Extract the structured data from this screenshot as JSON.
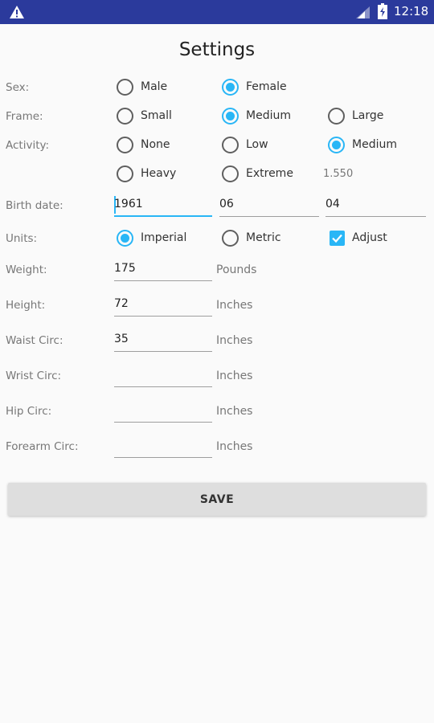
{
  "status_bar": {
    "time": "12:18"
  },
  "title": "Settings",
  "sex": {
    "label": "Sex:",
    "options": [
      "Male",
      "Female"
    ],
    "selected": "Female"
  },
  "frame": {
    "label": "Frame:",
    "options": [
      "Small",
      "Medium",
      "Large"
    ],
    "selected": "Medium"
  },
  "activity": {
    "label": "Activity:",
    "options": [
      "None",
      "Low",
      "Medium",
      "Heavy",
      "Extreme"
    ],
    "selected": "Medium",
    "factor": "1.550"
  },
  "birth_date": {
    "label": "Birth date:",
    "year": "1961",
    "month": "06",
    "day": "04"
  },
  "units": {
    "label": "Units:",
    "options": [
      "Imperial",
      "Metric"
    ],
    "selected": "Imperial",
    "adjust_label": "Adjust",
    "adjust_checked": true
  },
  "weight": {
    "label": "Weight:",
    "value": "175",
    "unit": "Pounds"
  },
  "height": {
    "label": "Height:",
    "value": "72",
    "unit": "Inches"
  },
  "waist": {
    "label": "Waist Circ:",
    "value": "35",
    "unit": "Inches"
  },
  "wrist": {
    "label": "Wrist Circ:",
    "value": "",
    "unit": "Inches"
  },
  "hip": {
    "label": "Hip Circ:",
    "value": "",
    "unit": "Inches"
  },
  "forearm": {
    "label": "Forearm Circ:",
    "value": "",
    "unit": "Inches"
  },
  "save_label": "SAVE",
  "colors": {
    "status_bar": "#2b3a9c",
    "accent": "#29b6f6",
    "button": "#dedede"
  }
}
